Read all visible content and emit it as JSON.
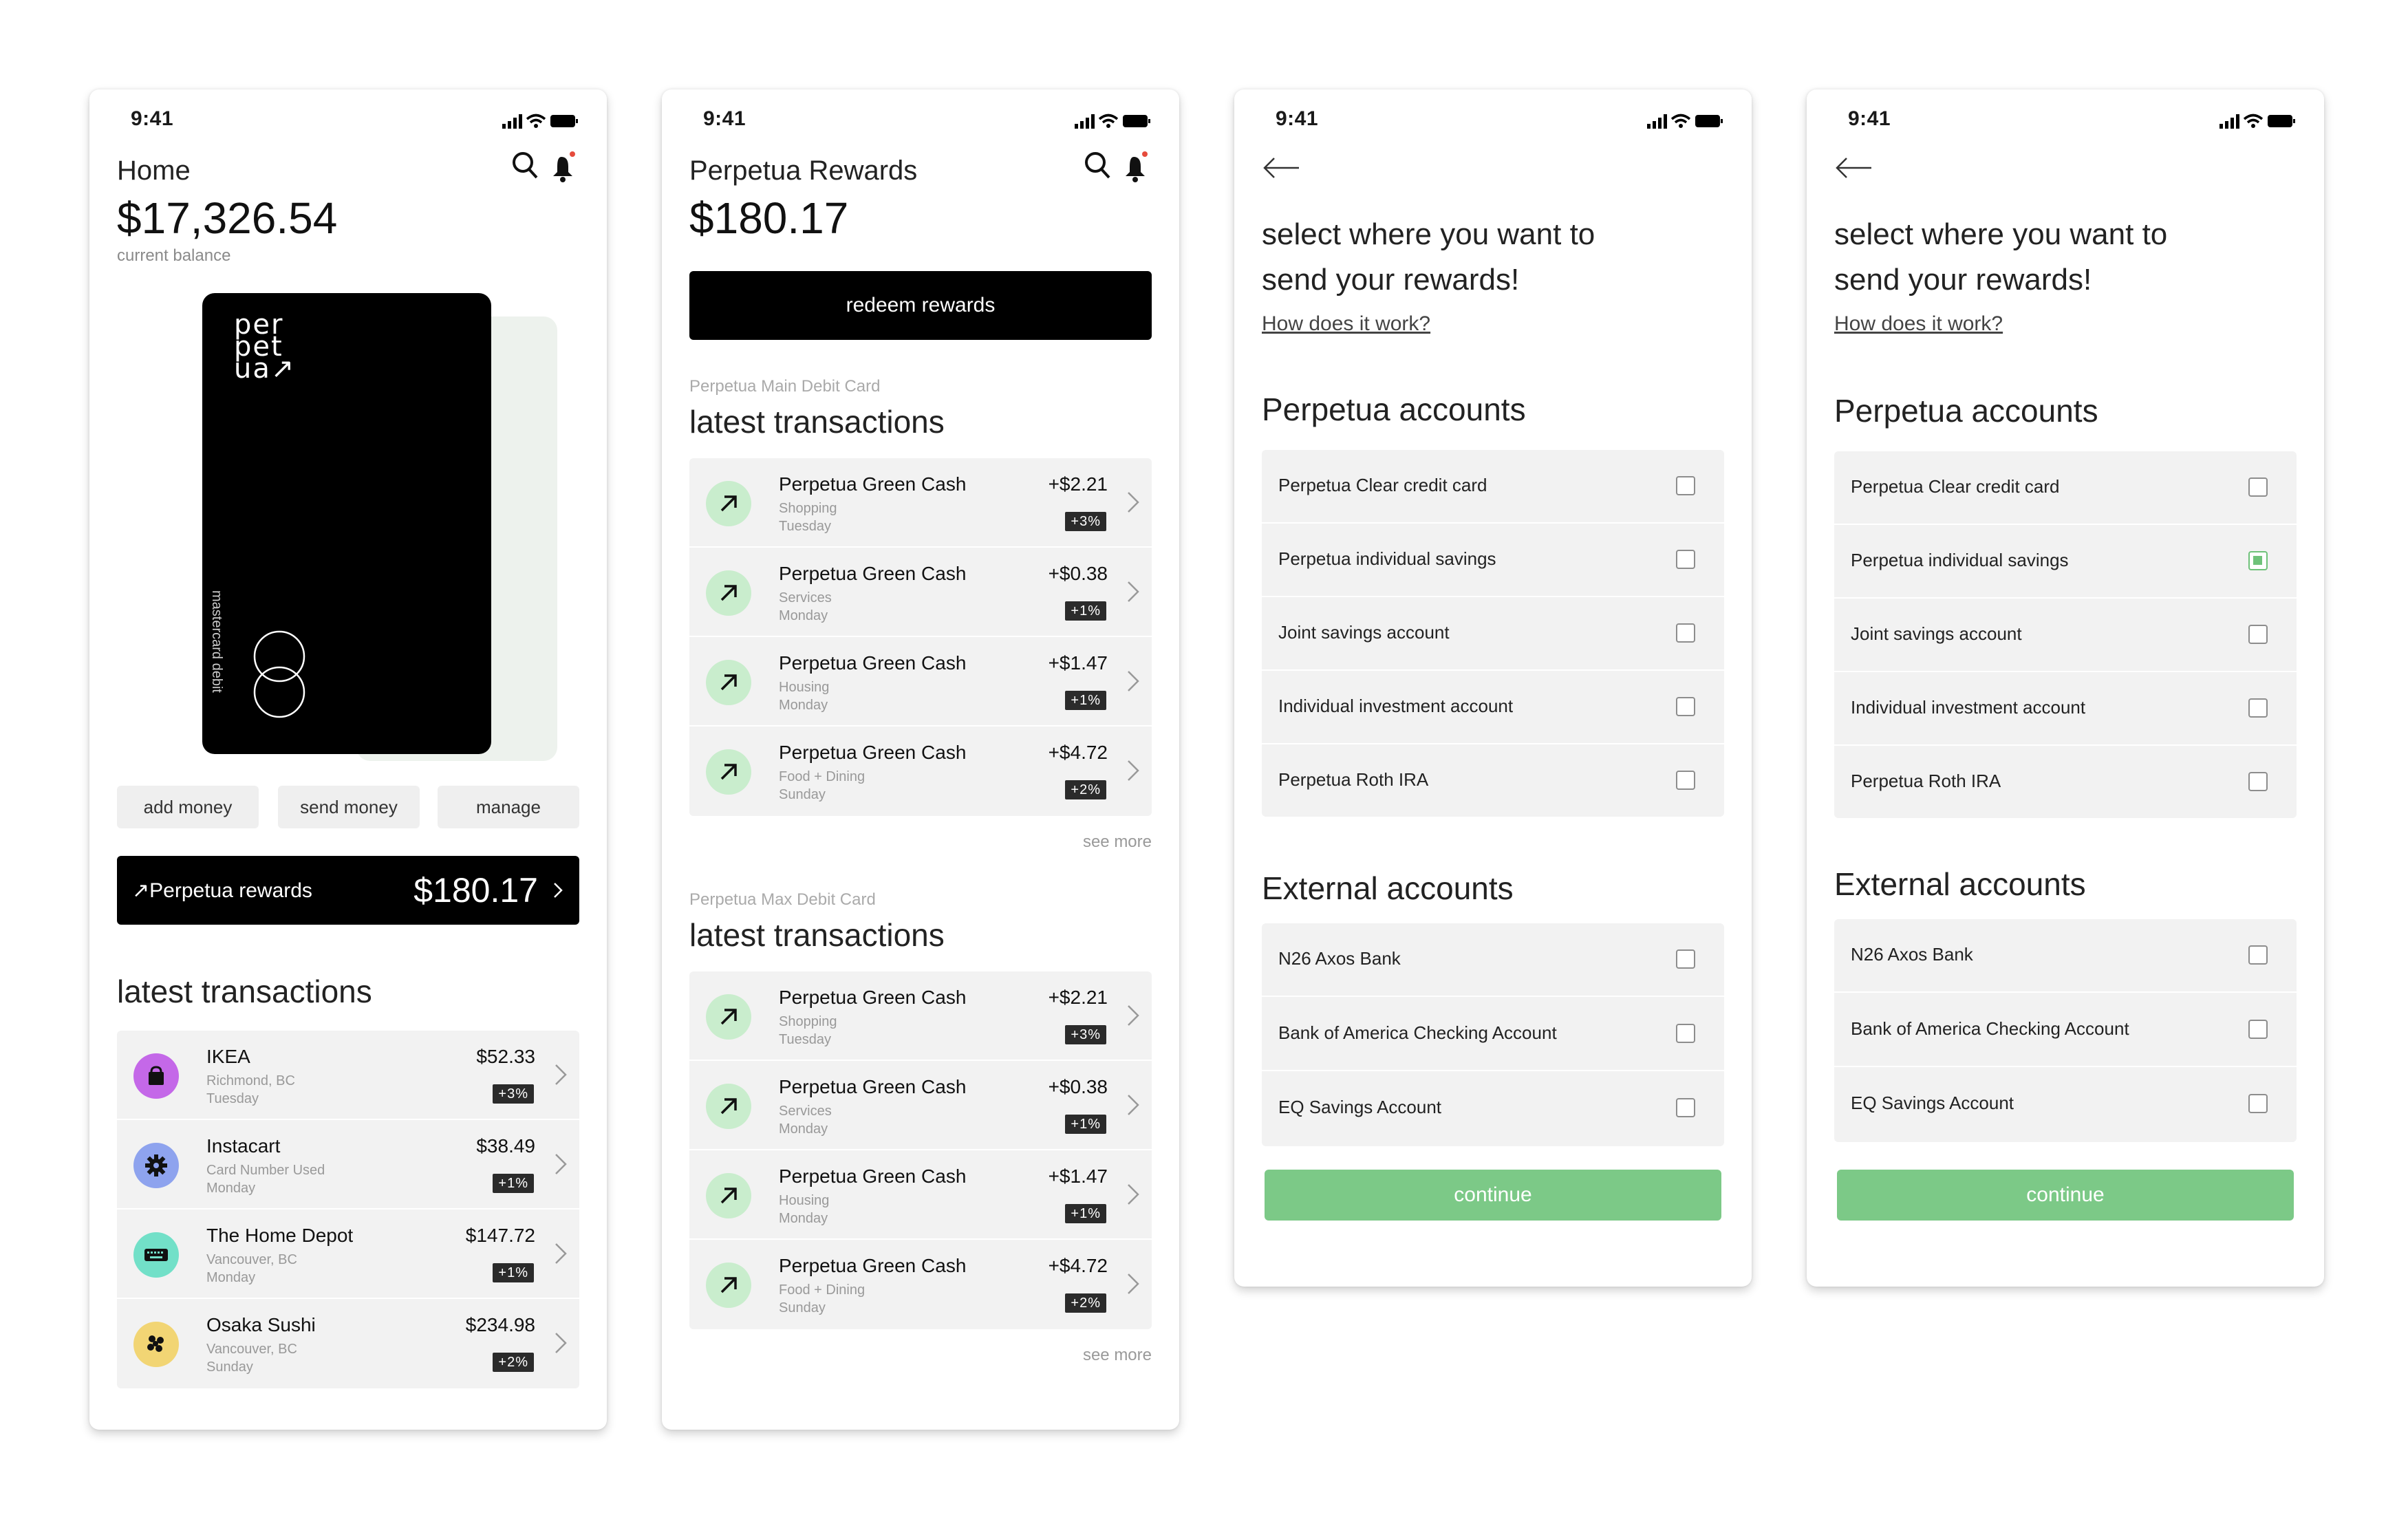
{
  "status": {
    "time": "9:41"
  },
  "home": {
    "title": "Home",
    "balance": "$17,326.54",
    "balance_label": "current balance",
    "card": {
      "brand_lines": [
        "per",
        "pet",
        "ua↗"
      ],
      "type_label": "mastercard debit"
    },
    "actions": [
      "add money",
      "send money",
      "manage"
    ],
    "rewards_bar": {
      "label": "↗Perpetua rewards",
      "amount": "$180.17"
    },
    "section_title": "latest transactions",
    "transactions": [
      {
        "name": "IKEA",
        "sub1": "Richmond, BC",
        "sub2": "Tuesday",
        "amount": "$52.33",
        "badge": "+3%",
        "icon": "shopping-bag-icon",
        "color": "#c468e8"
      },
      {
        "name": "Instacart",
        "sub1": "Card Number Used",
        "sub2": "Monday",
        "amount": "$38.49",
        "badge": "+1%",
        "icon": "gear-icon",
        "color": "#8ea3ee"
      },
      {
        "name": "The Home Depot",
        "sub1": "Vancouver, BC",
        "sub2": "Monday",
        "amount": "$147.72",
        "badge": "+1%",
        "icon": "keyboard-icon",
        "color": "#72e0c8"
      },
      {
        "name": "Osaka Sushi",
        "sub1": "Vancouver, BC",
        "sub2": "Sunday",
        "amount": "$234.98",
        "badge": "+2%",
        "icon": "dots-cluster-icon",
        "color": "#f2d574"
      }
    ]
  },
  "rewards": {
    "title": "Perpetua Rewards",
    "amount": "$180.17",
    "redeem_label": "redeem rewards",
    "sections": [
      {
        "card_label": "Perpetua Main Debit Card",
        "title": "latest transactions",
        "see_more": "see more",
        "items": [
          {
            "name": "Perpetua Green Cash",
            "category": "Shopping",
            "day": "Tuesday",
            "amount": "+$2.21",
            "badge": "+3%"
          },
          {
            "name": "Perpetua Green Cash",
            "category": "Services",
            "day": "Monday",
            "amount": "+$0.38",
            "badge": "+1%"
          },
          {
            "name": "Perpetua Green Cash",
            "category": "Housing",
            "day": "Monday",
            "amount": "+$1.47",
            "badge": "+1%"
          },
          {
            "name": "Perpetua Green Cash",
            "category": "Food + Dining",
            "day": "Sunday",
            "amount": "+$4.72",
            "badge": "+2%"
          }
        ]
      },
      {
        "card_label": "Perpetua Max Debit Card",
        "title": "latest transactions",
        "see_more": "see more",
        "items": [
          {
            "name": "Perpetua Green Cash",
            "category": "Shopping",
            "day": "Tuesday",
            "amount": "+$2.21",
            "badge": "+3%"
          },
          {
            "name": "Perpetua Green Cash",
            "category": "Services",
            "day": "Monday",
            "amount": "+$0.38",
            "badge": "+1%"
          },
          {
            "name": "Perpetua Green Cash",
            "category": "Housing",
            "day": "Monday",
            "amount": "+$1.47",
            "badge": "+1%"
          },
          {
            "name": "Perpetua Green Cash",
            "category": "Food + Dining",
            "day": "Sunday",
            "amount": "+$4.72",
            "badge": "+2%"
          }
        ]
      }
    ]
  },
  "select": {
    "question_line1": "select where you want to",
    "question_line2": "send your rewards!",
    "help_link": "How does it work?",
    "perpetua_title": "Perpetua accounts",
    "perpetua_accounts": [
      "Perpetua Clear credit card",
      "Perpetua individual savings",
      "Joint savings account",
      "Individual investment account",
      "Perpetua Roth IRA"
    ],
    "external_title": "External accounts",
    "external_accounts": [
      "N26 Axos Bank",
      "Bank of America Checking Account",
      "EQ Savings Account"
    ],
    "continue_label": "continue",
    "selected_in_second_screen": "Perpetua individual savings"
  },
  "colors": {
    "reward_green": "#c9edcd",
    "continue_green": "#7cc987",
    "check_green": "#6fc27a"
  }
}
